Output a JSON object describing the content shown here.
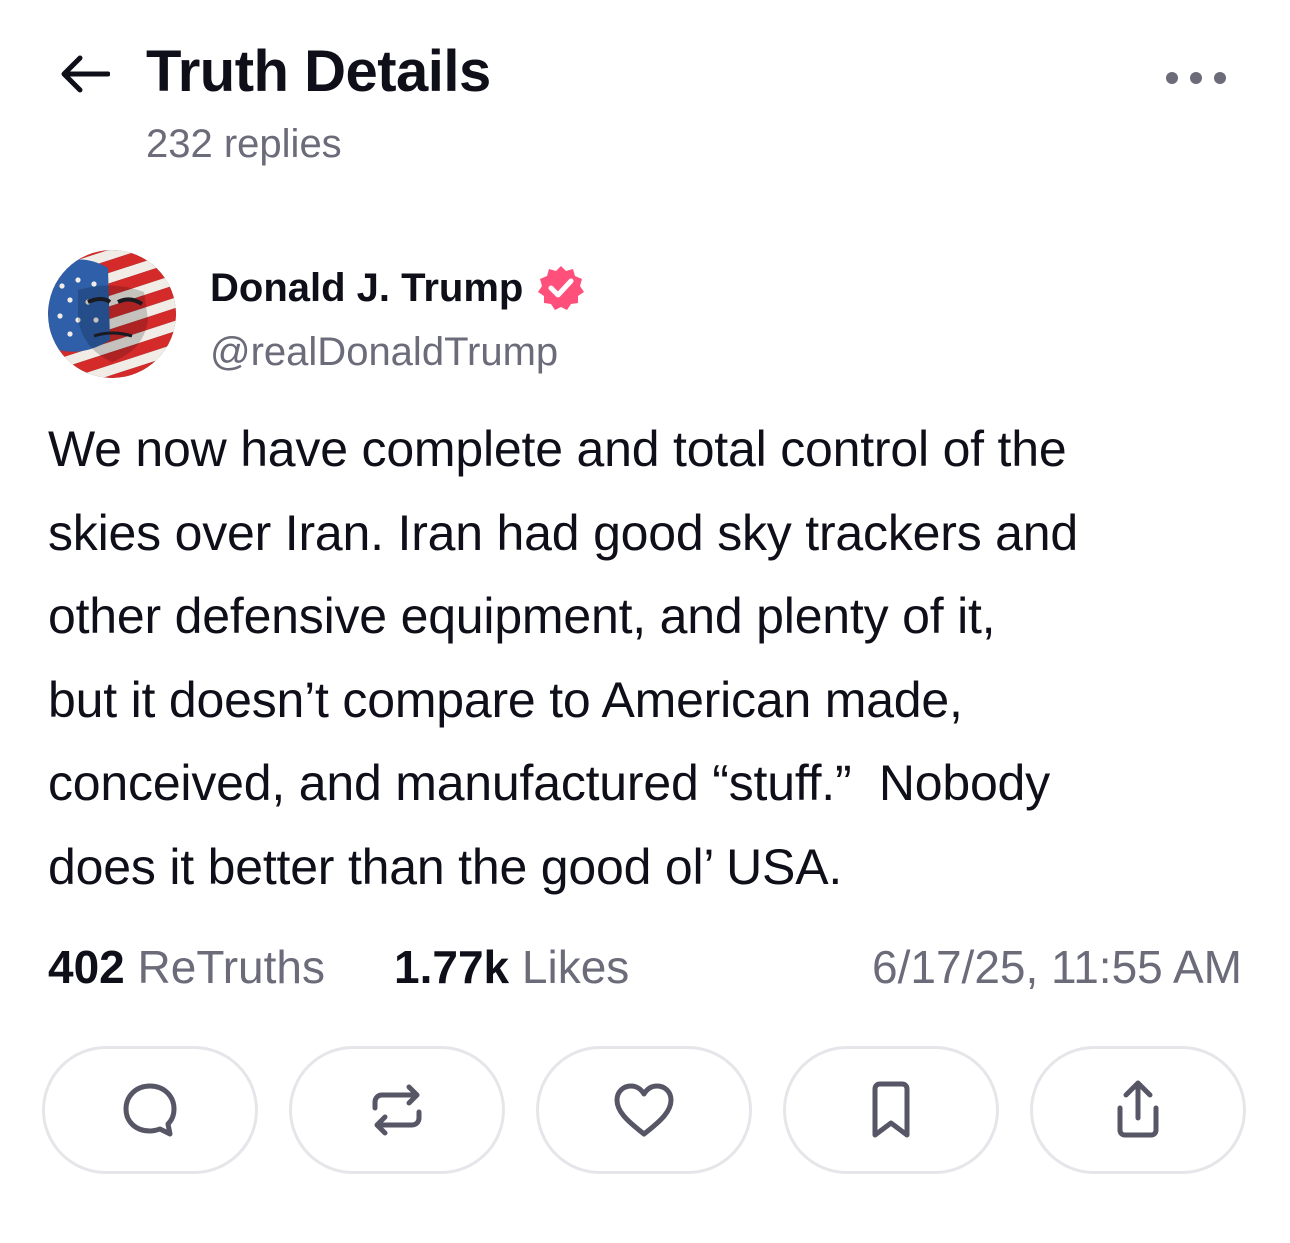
{
  "header": {
    "title": "Truth Details",
    "replies": "232 replies",
    "back_icon": "arrow-left-icon",
    "more_icon": "more-horizontal-icon"
  },
  "author": {
    "name": "Donald J. Trump",
    "handle": "@realDonaldTrump",
    "verified": true,
    "verified_color": "#ff4f7b"
  },
  "post": {
    "lines": [
      "We now have complete and total control of the",
      "skies over Iran. Iran had good sky trackers and",
      "other defensive equipment, and plenty of it,",
      "but it doesn’t compare to American made,",
      "conceived, and manufactured “stuff.”  Nobody",
      "does it better than the good ol’ USA."
    ]
  },
  "stats": {
    "retruths_count": "402",
    "retruths_label": "ReTruths",
    "likes_count": "1.77k",
    "likes_label": "Likes",
    "timestamp": "6/17/25, 11:55 AM"
  },
  "actions": [
    {
      "name": "reply",
      "icon": "comment-icon"
    },
    {
      "name": "retruth",
      "icon": "repost-icon"
    },
    {
      "name": "like",
      "icon": "heart-icon"
    },
    {
      "name": "bookmark",
      "icon": "bookmark-icon"
    },
    {
      "name": "share",
      "icon": "share-icon"
    }
  ],
  "colors": {
    "text_primary": "#0f0f1a",
    "text_secondary": "#6b6b7a",
    "border": "#e6e6ea",
    "icon": "#565666"
  }
}
